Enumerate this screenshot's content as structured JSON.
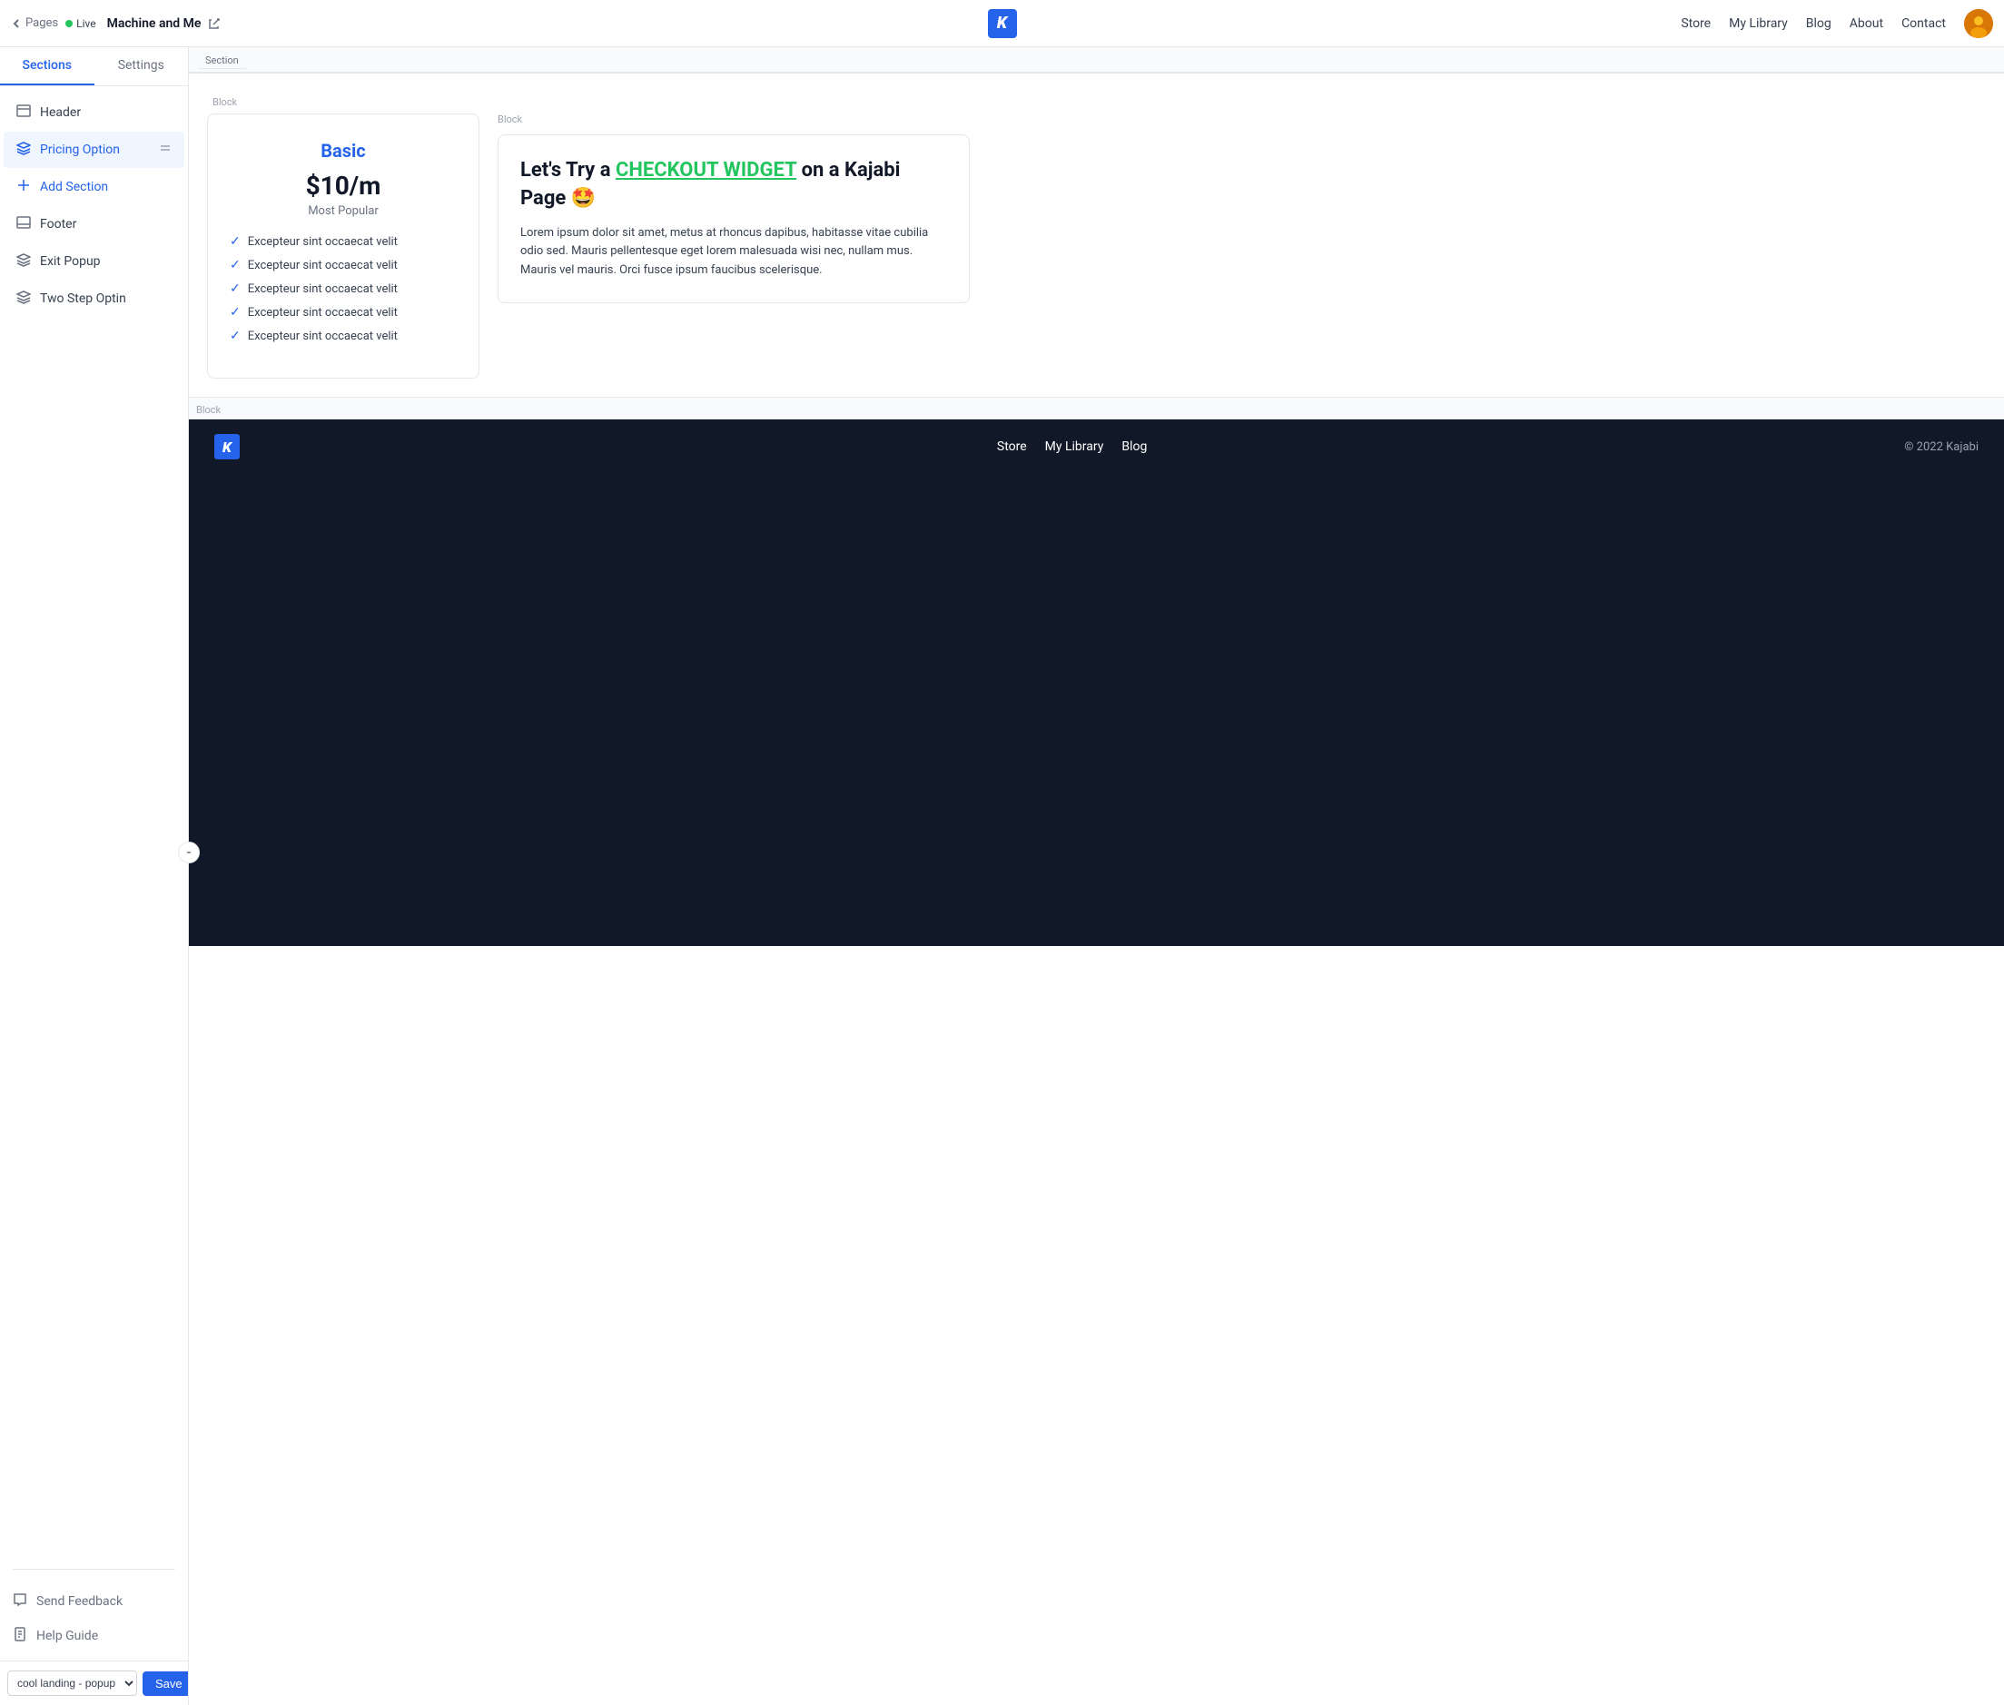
{
  "topNav": {
    "pagesLabel": "Pages",
    "liveLabel": "Live",
    "siteTitle": "Machine and Me",
    "logoK": "K",
    "navLinks": [
      "Store",
      "My Library",
      "Blog",
      "About",
      "Contact"
    ]
  },
  "sidebar": {
    "tabs": [
      {
        "label": "Sections",
        "active": true
      },
      {
        "label": "Settings",
        "active": false
      }
    ],
    "sections": [
      {
        "id": "header",
        "label": "Header",
        "icon": "header-icon"
      },
      {
        "id": "pricing-option",
        "label": "Pricing Option",
        "icon": "layers-icon",
        "draggable": true
      },
      {
        "id": "add-section",
        "label": "Add Section",
        "icon": "plus-icon",
        "isAdd": true
      },
      {
        "id": "footer",
        "label": "Footer",
        "icon": "footer-icon"
      },
      {
        "id": "exit-popup",
        "label": "Exit Popup",
        "icon": "layers-icon"
      },
      {
        "id": "two-step-optin",
        "label": "Two Step Optin",
        "icon": "layers-icon"
      }
    ],
    "bottomItems": [
      {
        "id": "send-feedback",
        "label": "Send Feedback",
        "icon": "chat-icon"
      },
      {
        "id": "help-guide",
        "label": "Help Guide",
        "icon": "doc-icon"
      }
    ],
    "footerDropdown": {
      "value": "cool landing - popup",
      "options": [
        "cool landing - popup"
      ]
    },
    "saveLabel": "Save"
  },
  "canvas": {
    "sectionLabel": "Section",
    "blockLabel": "Block",
    "pricing": {
      "plan": "Basic",
      "price": "$10/m",
      "popular": "Most Popular",
      "features": [
        "Excepteur sint occaecat velit",
        "Excepteur sint occaecat velit",
        "Excepteur sint occaecat velit",
        "Excepteur sint occaecat velit",
        "Excepteur sint occaecat velit"
      ]
    },
    "checkoutWidget": {
      "titleStart": "Let's Try a ",
      "titleLink": "CHECKOUT WIDGET",
      "titleEnd": " on a Kajabi Page 🤩",
      "description": "Lorem ipsum dolor sit amet, metus at rhoncus dapibus, habitasse vitae cubilia odio sed. Mauris pellentesque eget lorem malesuada wisi nec, nullam mus. Mauris vel mauris. Orci fusce ipsum faucibus scelerisque."
    },
    "footer": {
      "logoK": "K",
      "navLinks": [
        "Store",
        "My Library",
        "Blog"
      ],
      "copyright": "© 2022 Kajabi"
    }
  }
}
